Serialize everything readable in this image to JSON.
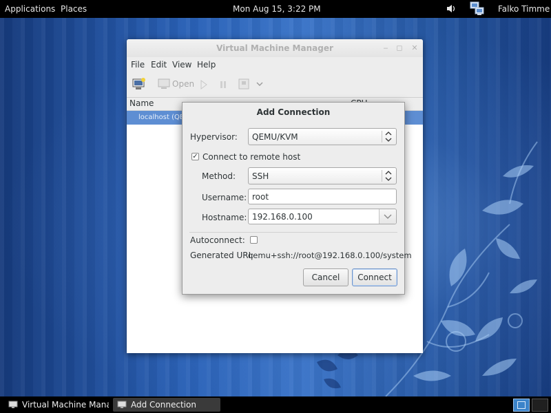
{
  "top_panel": {
    "applications": "Applications",
    "places": "Places",
    "clock": "Mon Aug 15,  3:22 PM",
    "user": "Falko Timme",
    "icons": [
      "volume-icon",
      "network-icon"
    ]
  },
  "vmm_window": {
    "title": "Virtual Machine Manager",
    "menu": [
      "File",
      "Edit",
      "View",
      "Help"
    ],
    "toolbar": {
      "open_label": "Open",
      "icons": [
        "new-vm-icon",
        "open-console-icon",
        "run-icon",
        "pause-icon",
        "shutdown-icon",
        "dropdown-arrow-icon"
      ]
    },
    "columns": {
      "name": "Name",
      "cpu": "CPU"
    },
    "rows": [
      {
        "name": "localhost (QEMU)"
      }
    ]
  },
  "dialog": {
    "title": "Add Connection",
    "hypervisor_label": "Hypervisor:",
    "hypervisor_value": "QEMU/KVM",
    "remote_label": "Connect to remote host",
    "remote_checked": true,
    "method_label": "Method:",
    "method_value": "SSH",
    "username_label": "Username:",
    "username_value": "root",
    "hostname_label": "Hostname:",
    "hostname_value": "192.168.0.100",
    "autoconnect_label": "Autoconnect:",
    "autoconnect_checked": false,
    "uri_label": "Generated URI:",
    "uri_value": "qemu+ssh://root@192.168.0.100/system",
    "cancel_label": "Cancel",
    "connect_label": "Connect"
  },
  "taskbar": {
    "tasks": [
      {
        "label": "Virtual Machine Mana...",
        "active": false
      },
      {
        "label": "Add Connection",
        "active": true
      }
    ]
  },
  "colors": {
    "selection": "#5e8ed3",
    "desktop": "#2a62b8",
    "panel": "#000000"
  }
}
